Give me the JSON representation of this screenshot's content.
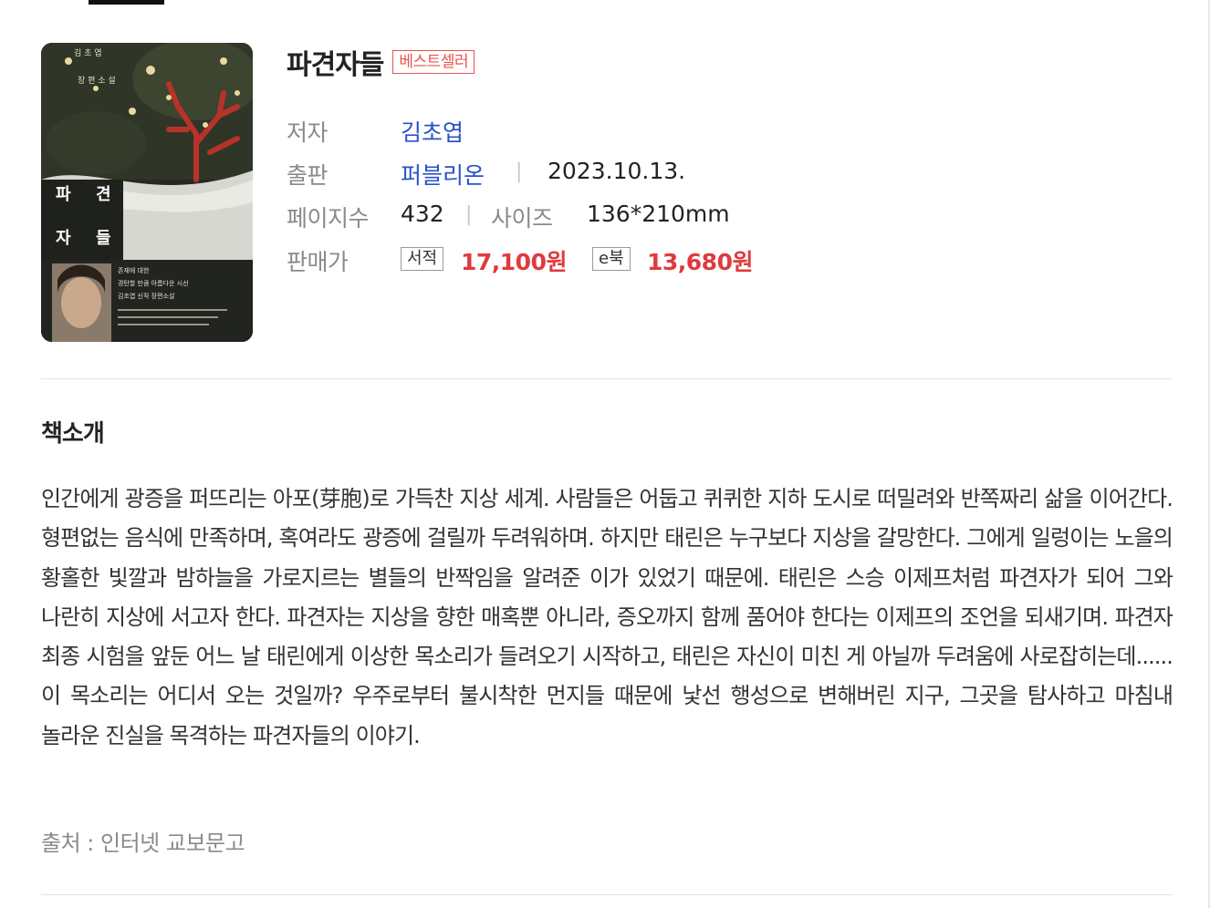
{
  "book": {
    "title": "파견자들",
    "badge": "베스트셀러",
    "cover_alt": "파견자들 표지"
  },
  "info": {
    "author_label": "저자",
    "author": "김초엽",
    "publisher_label": "출판",
    "publisher": "퍼블리온",
    "date": "2023.10.13.",
    "pages_label": "페이지수",
    "pages": "432",
    "size_label": "사이즈",
    "size": "136*210mm",
    "price_label": "판매가",
    "print_tag": "서적",
    "print_price": "17,100원",
    "ebook_tag": "e북",
    "ebook_price": "13,680원",
    "separator": "|"
  },
  "intro": {
    "heading": "책소개",
    "body": "인간에게 광증을 퍼뜨리는 아포(芽胞)로 가득찬 지상 세계. 사람들은 어둡고 퀴퀴한 지하 도시로 떠밀려와 반쪽짜리 삶을 이어간다. 형편없는 음식에 만족하며, 혹여라도 광증에 걸릴까 두려워하며. 하지만 태린은 누구보다 지상을 갈망한다. 그에게 일렁이는 노을의 황홀한 빛깔과 밤하늘을 가로지르는 별들의 반짝임을 알려준 이가 있었기 때문에. 태린은 스승 이제프처럼 파견자가 되어 그와 나란히 지상에 서고자 한다. 파견자는 지상을 향한 매혹뿐 아니라, 증오까지 함께 품어야 한다는 이제프의 조언을 되새기며. 파견자 최종 시험을 앞둔 어느 날 태린에게 이상한 목소리가 들려오기 시작하고, 태린은 자신이 미친 게 아닐까 두려움에 사로잡히는데...... 이 목소리는 어디서 오는 것일까? 우주로부터 불시착한 먼지들 때문에 낯선 행성으로 변해버린 지구, 그곳을 탐사하고 마침내 놀라운 진실을 목격하는 파견자들의 이야기.",
    "source": "출처 : 인터넷 교보문고"
  },
  "cover_text": {
    "author_small": "김 초 엽",
    "genre": "장 편 소 설",
    "title_line1_a": "파",
    "title_line1_b": "견",
    "title_line2_a": "자",
    "title_line2_b": "들",
    "blurb1": "존재에 대한",
    "blurb2": "경탄할 만큼 아름다운 시선",
    "blurb3": "김초엽 신작 장편소설"
  },
  "colors": {
    "accent_red": "#e03a3e",
    "link_blue": "#2a52c9",
    "badge_red": "#e8534d"
  }
}
